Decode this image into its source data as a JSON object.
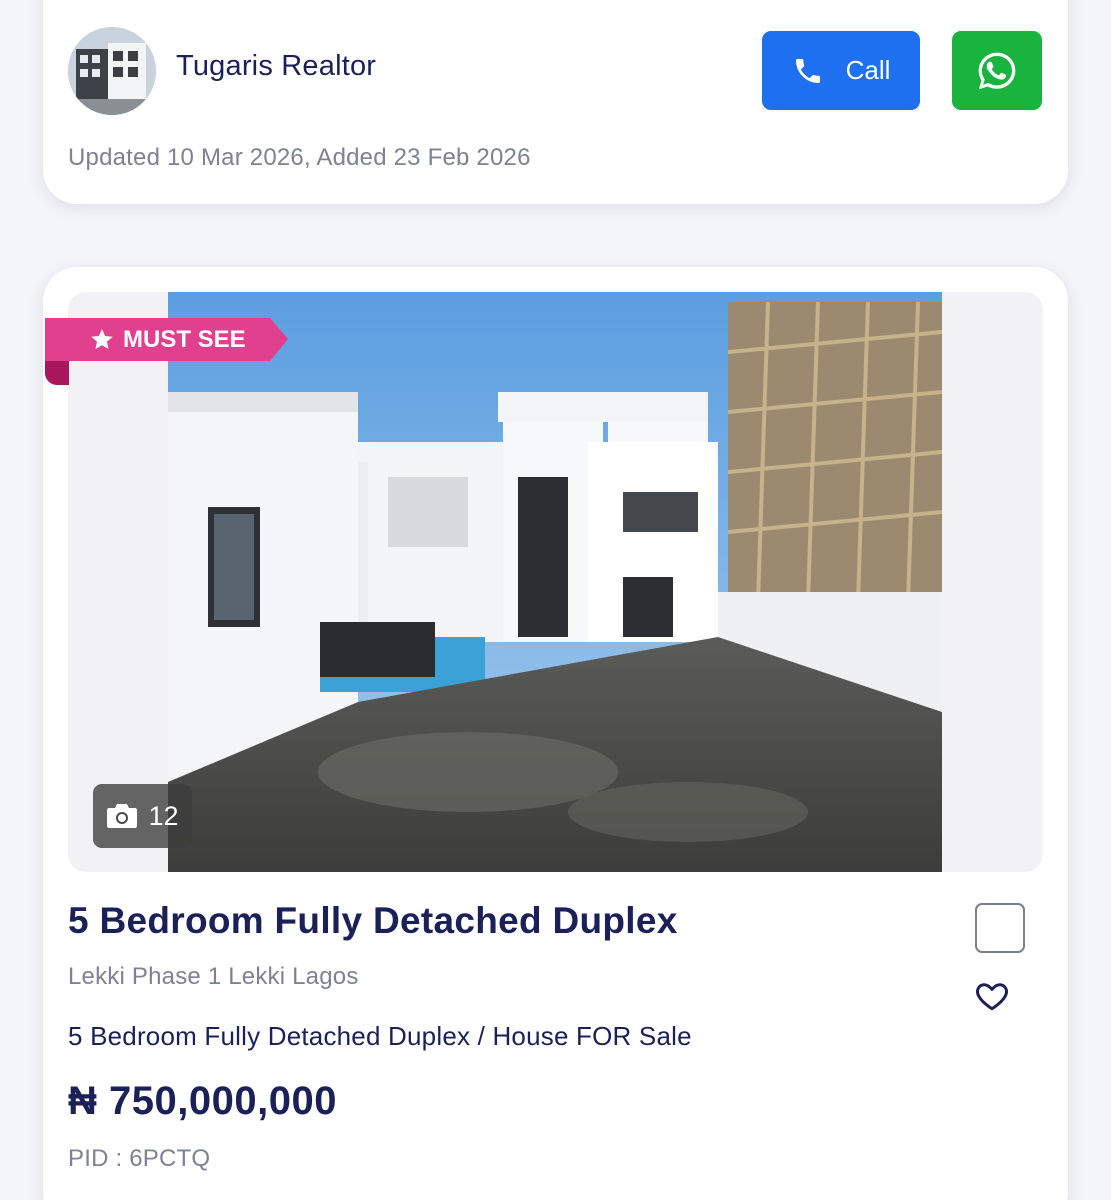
{
  "agent": {
    "name": "Tugaris Realtor",
    "updated": "Updated 10 Mar 2026, Added 23 Feb 2026",
    "call_label": "Call",
    "call_icon": "phone-icon",
    "whatsapp_icon": "whatsapp-icon"
  },
  "listing": {
    "badge": "MUST SEE",
    "badge_icon": "star-icon",
    "photo_count": "12",
    "photo_icon": "camera-icon",
    "title": "5 Bedroom Fully Detached Duplex",
    "location": "Lekki Phase 1 Lekki Lagos",
    "subtitle": "5 Bedroom Fully Detached Duplex / House FOR Sale",
    "price": "₦ 750,000,000",
    "pid": "PID : 6PCTQ",
    "favorite_icon": "heart-icon",
    "compare_icon": "checkbox-icon"
  },
  "colors": {
    "primary_text": "#1b2158",
    "muted_text": "#7d8294",
    "call_button": "#1f6ff1",
    "whatsapp_button": "#19b43e",
    "badge": "#e0408e"
  }
}
